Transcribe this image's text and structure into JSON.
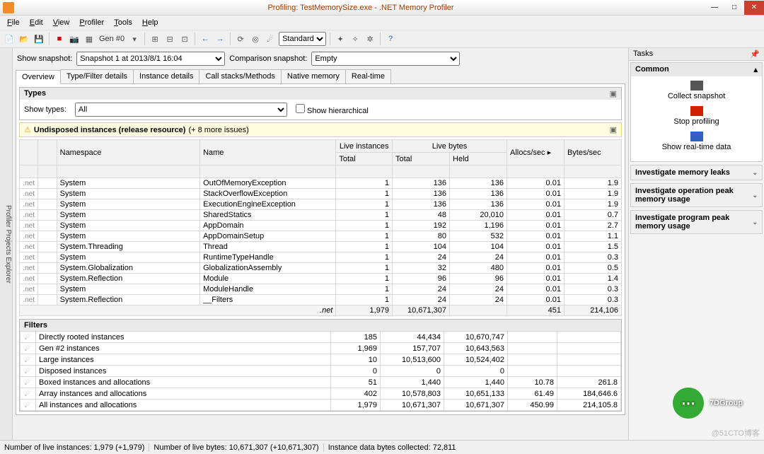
{
  "window": {
    "title": "Profiling: TestMemorySize.exe - .NET Memory Profiler"
  },
  "menu": [
    "File",
    "Edit",
    "View",
    "Profiler",
    "Tools",
    "Help"
  ],
  "toolbar": {
    "gen_label": "Gen #0",
    "combo_value": "Standard"
  },
  "snapshot": {
    "show_label": "Show snapshot:",
    "show_value": "Snapshot 1 at 2013/8/1 16:04",
    "compare_label": "Comparison snapshot:",
    "compare_value": "Empty"
  },
  "tabs": [
    "Overview",
    "Type/Filter details",
    "Instance details",
    "Call stacks/Methods",
    "Native memory",
    "Real-time"
  ],
  "types": {
    "header": "Types",
    "show_types_label": "Show types:",
    "show_types_value": "All",
    "hierarchical_label": "Show hierarchical"
  },
  "warning": {
    "bold": "Undisposed instances (release resource)",
    "rest": "(+ 8 more issues)"
  },
  "columns": {
    "namespace": "Namespace",
    "name": "Name",
    "live_instances": "Live instances",
    "live_bytes": "Live bytes",
    "total1": "Total",
    "total2": "Total",
    "held": "Held",
    "allocs": "Allocs/sec",
    "bytes": "Bytes/sec"
  },
  "rows": [
    {
      "ns": "System",
      "name": "OutOfMemoryException",
      "li": "1",
      "lb": "136",
      "held": "136",
      "as": "0.01",
      "bs": "1.9"
    },
    {
      "ns": "System",
      "name": "StackOverflowException",
      "li": "1",
      "lb": "136",
      "held": "136",
      "as": "0.01",
      "bs": "1.9"
    },
    {
      "ns": "System",
      "name": "ExecutionEngineException",
      "li": "1",
      "lb": "136",
      "held": "136",
      "as": "0.01",
      "bs": "1.9"
    },
    {
      "ns": "System",
      "name": "SharedStatics",
      "li": "1",
      "lb": "48",
      "held": "20,010",
      "as": "0.01",
      "bs": "0.7"
    },
    {
      "ns": "System",
      "name": "AppDomain",
      "li": "1",
      "lb": "192",
      "held": "1,196",
      "as": "0.01",
      "bs": "2.7"
    },
    {
      "ns": "System",
      "name": "AppDomainSetup",
      "li": "1",
      "lb": "80",
      "held": "532",
      "as": "0.01",
      "bs": "1.1"
    },
    {
      "ns": "System.Threading",
      "name": "Thread",
      "li": "1",
      "lb": "104",
      "held": "104",
      "as": "0.01",
      "bs": "1.5"
    },
    {
      "ns": "System",
      "name": "RuntimeTypeHandle",
      "li": "1",
      "lb": "24",
      "held": "24",
      "as": "0.01",
      "bs": "0.3"
    },
    {
      "ns": "System.Globalization",
      "name": "GlobalizationAssembly",
      "li": "1",
      "lb": "32",
      "held": "480",
      "as": "0.01",
      "bs": "0.5"
    },
    {
      "ns": "System.Reflection",
      "name": "Module",
      "li": "1",
      "lb": "96",
      "held": "96",
      "as": "0.01",
      "bs": "1.4"
    },
    {
      "ns": "System",
      "name": "ModuleHandle",
      "li": "1",
      "lb": "24",
      "held": "24",
      "as": "0.01",
      "bs": "0.3"
    },
    {
      "ns": "System.Reflection",
      "name": "__Filters",
      "li": "1",
      "lb": "24",
      "held": "24",
      "as": "0.01",
      "bs": "0.3"
    }
  ],
  "total_row": {
    "tag": ".net",
    "li": "1,979",
    "lb": "10,671,307",
    "held": "",
    "as": "451",
    "bs": "214,106"
  },
  "filters": {
    "header": "Filters",
    "rows": [
      {
        "name": "Directly rooted instances",
        "c1": "185",
        "c2": "44,434",
        "c3": "10,670,747",
        "c4": "",
        "c5": ""
      },
      {
        "name": "Gen #2 instances",
        "c1": "1,969",
        "c2": "157,707",
        "c3": "10,643,563",
        "c4": "",
        "c5": ""
      },
      {
        "name": "Large instances",
        "c1": "10",
        "c2": "10,513,600",
        "c3": "10,524,402",
        "c4": "",
        "c5": ""
      },
      {
        "name": "Disposed instances",
        "c1": "0",
        "c2": "0",
        "c3": "0",
        "c4": "",
        "c5": ""
      },
      {
        "name": "Boxed instances and allocations",
        "c1": "51",
        "c2": "1,440",
        "c3": "1,440",
        "c4": "10.78",
        "c5": "261.8"
      },
      {
        "name": "Array instances and allocations",
        "c1": "402",
        "c2": "10,578,803",
        "c3": "10,651,133",
        "c4": "61.49",
        "c5": "184,646.6"
      },
      {
        "name": "All instances and allocations",
        "c1": "1,979",
        "c2": "10,671,307",
        "c3": "10,671,307",
        "c4": "450.99",
        "c5": "214,105.8"
      }
    ]
  },
  "tasks": {
    "header": "Tasks",
    "common": "Common",
    "collect": "Collect snapshot",
    "stop": "Stop profiling",
    "realtime": "Show real-time data",
    "inv1": "Investigate memory leaks",
    "inv2": "Investigate operation peak memory usage",
    "inv3": "Investigate program peak memory usage"
  },
  "status": {
    "p1": "Number of live instances: 1,979 (+1,979)",
    "p2": "Number of live bytes: 10,671,307 (+10,671,307)",
    "p3": "Instance data bytes collected: 72,811"
  },
  "watermark": "@51CTO博客",
  "overlay": "7DGroup"
}
